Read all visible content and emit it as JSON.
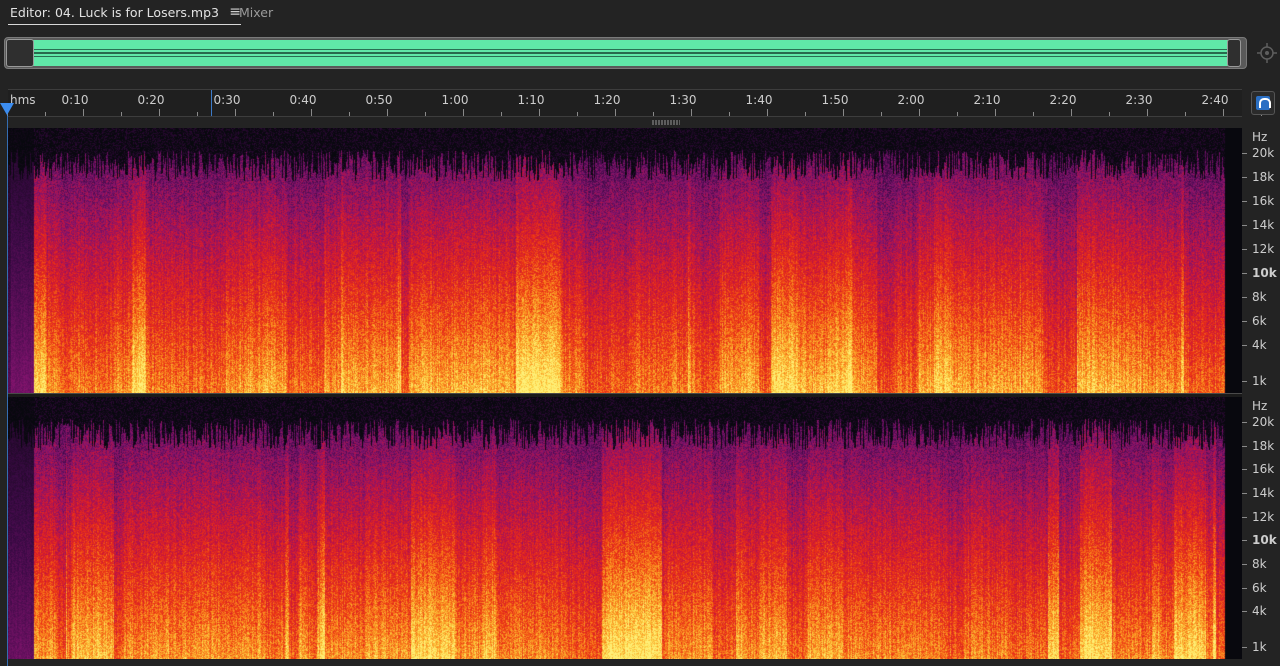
{
  "tabs": {
    "editor_label": "Editor: 04. Luck is for Losers.mp3",
    "editor_menu": "≡",
    "mixer_label": "Mixer"
  },
  "ruler": {
    "unit": "hms",
    "labels": [
      "0:10",
      "0:20",
      "0:30",
      "0:40",
      "0:50",
      "1:00",
      "1:10",
      "1:20",
      "1:30",
      "1:40",
      "1:50",
      "2:00",
      "2:10",
      "2:20",
      "2:30",
      "2:40"
    ]
  },
  "frequency_axis": {
    "unit": "Hz",
    "labels": [
      {
        "text": "20k",
        "khz": 20,
        "bold": false
      },
      {
        "text": "18k",
        "khz": 18,
        "bold": false
      },
      {
        "text": "16k",
        "khz": 16,
        "bold": false
      },
      {
        "text": "14k",
        "khz": 14,
        "bold": false
      },
      {
        "text": "12k",
        "khz": 12,
        "bold": false
      },
      {
        "text": "10k",
        "khz": 10,
        "bold": true
      },
      {
        "text": "8k",
        "khz": 8,
        "bold": false
      },
      {
        "text": "6k",
        "khz": 6,
        "bold": false
      },
      {
        "text": "4k",
        "khz": 4,
        "bold": false
      },
      {
        "text": "1k",
        "khz": 1,
        "bold": false
      }
    ]
  },
  "colors": {
    "overview_waveform": "#60e8a8",
    "playhead": "#3c8df0",
    "snap_accent": "#2a6fc4"
  },
  "icons": {
    "tab_menu": "hamburger-menu-icon",
    "zoom": "zoom-to-fit-icon",
    "snap": "magnet-icon"
  }
}
